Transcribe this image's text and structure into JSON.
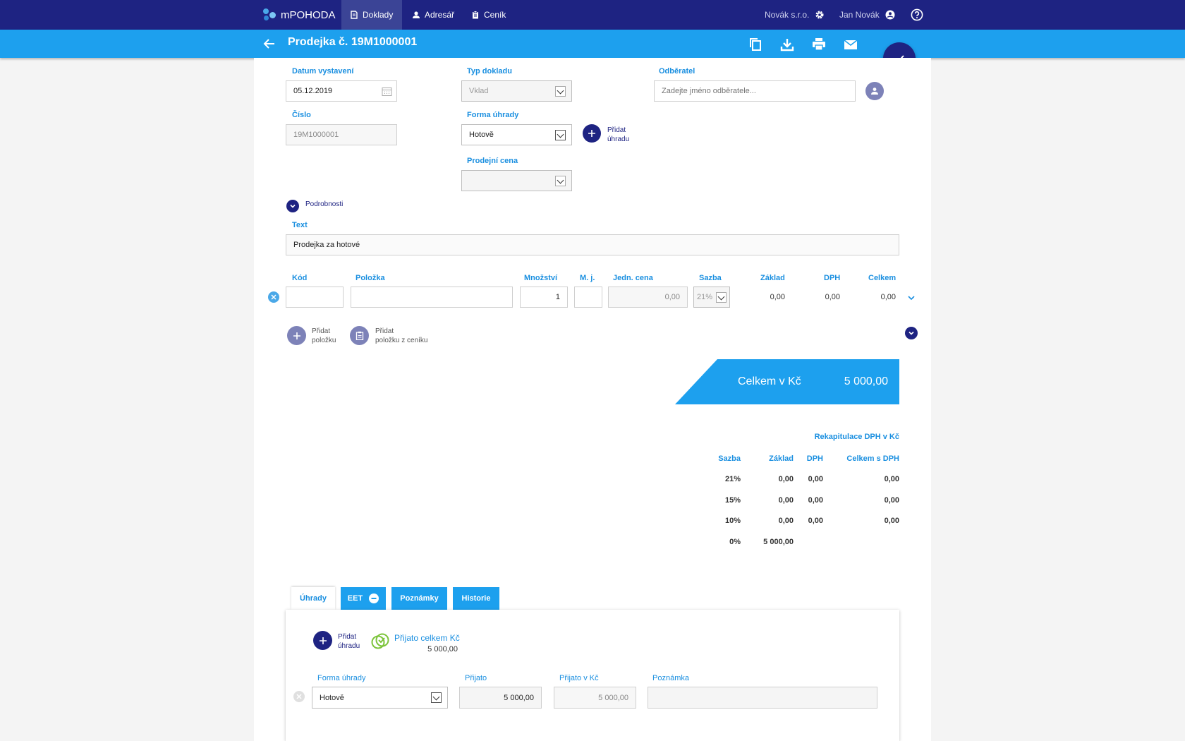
{
  "app": {
    "name": "mPOHODA"
  },
  "nav": {
    "tabs": [
      {
        "label": "Doklady",
        "icon": "documents-icon"
      },
      {
        "label": "Adresář",
        "icon": "person-icon"
      },
      {
        "label": "Ceník",
        "icon": "clipboard-icon"
      }
    ],
    "company": "Novák s.r.o.",
    "user": "Jan Novák"
  },
  "header": {
    "title": "Prodejka č. 19M1000001"
  },
  "form": {
    "date_label": "Datum vystavení",
    "date_value": "05.12.2019",
    "number_label": "Číslo",
    "number_value": "19M1000001",
    "doctype_label": "Typ dokladu",
    "doctype_value": "Vklad",
    "payment_label": "Forma úhrady",
    "payment_value": "Hotově",
    "add_payment_line1": "Přidat",
    "add_payment_line2": "úhradu",
    "price_label": "Prodejní cena",
    "price_value": "",
    "customer_label": "Odběratel",
    "customer_placeholder": "Zadejte jméno odběratele...",
    "details_label": "Podrobnosti",
    "text_label": "Text",
    "text_value": "Prodejka za hotové"
  },
  "items": {
    "headers": {
      "code": "Kód",
      "item": "Položka",
      "qty": "Množství",
      "unit": "M. j.",
      "unit_price": "Jedn. cena",
      "rate": "Sazba",
      "base": "Základ",
      "vat": "DPH",
      "total": "Celkem"
    },
    "row": {
      "code": "",
      "item": "",
      "qty": "1",
      "unit": "",
      "unit_price": "0,00",
      "rate": "21%",
      "base": "0,00",
      "vat": "0,00",
      "total": "0,00"
    },
    "add_item_line1": "Přidat",
    "add_item_line2": "položku",
    "add_from_list_line1": "Přidat",
    "add_from_list_line2": "položku z ceníku"
  },
  "summary": {
    "total_label": "Celkem v Kč",
    "total_value": "5 000,00"
  },
  "vat_recap": {
    "title": "Rekapitulace DPH v Kč",
    "headers": {
      "rate": "Sazba",
      "base": "Základ",
      "vat": "DPH",
      "total": "Celkem s DPH"
    },
    "rows": [
      {
        "rate": "21%",
        "base": "0,00",
        "vat": "0,00",
        "total": "0,00"
      },
      {
        "rate": "15%",
        "base": "0,00",
        "vat": "0,00",
        "total": "0,00"
      },
      {
        "rate": "10%",
        "base": "0,00",
        "vat": "0,00",
        "total": "0,00"
      },
      {
        "rate": "0%",
        "base": "5 000,00",
        "vat": "",
        "total": ""
      }
    ]
  },
  "bottom_tabs": [
    {
      "label": "Úhrady",
      "active": true
    },
    {
      "label": "EET"
    },
    {
      "label": "Poznámky"
    },
    {
      "label": "Historie"
    }
  ],
  "payments": {
    "add_line1": "Přidat",
    "add_line2": "úhradu",
    "received_total_label": "Přijato celkem Kč",
    "received_total_value": "5 000,00",
    "headers": {
      "method": "Forma úhrady",
      "received": "Přijato",
      "received_czk": "Přijato v Kč",
      "note": "Poznámka"
    },
    "row": {
      "method": "Hotově",
      "received": "5 000,00",
      "received_czk": "5 000,00",
      "note": ""
    }
  },
  "colors": {
    "nav": "#1e2382",
    "accent": "#1da0ee",
    "label": "#1a8fe0"
  }
}
